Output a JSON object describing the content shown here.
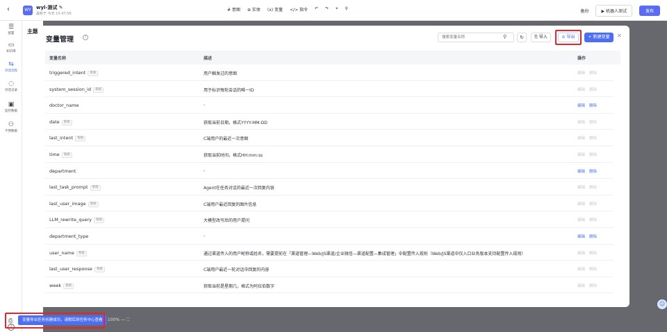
{
  "app": {
    "project_avatar": "WY",
    "project_name": "wyl-测试 ✎",
    "saved_text": "最新于 今天 15:47:56",
    "top_menu": [
      "# 意图",
      "⊕ 实体",
      "(x) 变量",
      "</> 指令",
      "↶",
      "↷",
      "⌖",
      "⚲"
    ],
    "backup_label": "备份",
    "test_label": "▶ 机器人测试",
    "publish_label": "发布",
    "left_nav": [
      {
        "label": "配置",
        "icon": "sliders-icon"
      },
      {
        "label": "知识库",
        "icon": "book-icon"
      },
      {
        "label": "对话流程",
        "icon": "flow-icon",
        "active": true
      },
      {
        "label": "对话记录",
        "icon": "chat-icon"
      },
      {
        "label": "监控数据",
        "icon": "monitor-icon"
      },
      {
        "label": "干预数据",
        "icon": "people-icon"
      }
    ],
    "subpanel_title": "主题",
    "zoom_text": "+  100%  —  ⛶",
    "toast": "变量导出任务创建成功，请稍后到任务中心查看"
  },
  "modal": {
    "title": "变量管理",
    "search_placeholder": "搜索变量名称",
    "import_label": "⎘ 导入",
    "export_label": "⊘ 导出",
    "new_label": "+ 新建变量",
    "close": "✕",
    "columns": {
      "name": "变量名称",
      "desc": "描述",
      "ops": "操作"
    },
    "edit_label": "编辑",
    "delete_label": "删除",
    "system_tag": "系统",
    "rows": [
      {
        "name": "triggered_intent",
        "system": true,
        "desc": "用户触发过的意图"
      },
      {
        "name": "system_session_id",
        "system": true,
        "desc": "用于标识每轮会话的唯一ID"
      },
      {
        "name": "doctor_name",
        "system": false,
        "desc": "-"
      },
      {
        "name": "date",
        "system": true,
        "desc": "获取当前日期，格式YYYY-MM-DD"
      },
      {
        "name": "last_intent",
        "system": true,
        "desc": "C端用户的最近一次意图"
      },
      {
        "name": "time",
        "system": true,
        "desc": "获取当前时间，格式HH:mm:ss"
      },
      {
        "name": "department",
        "system": false,
        "desc": "-"
      },
      {
        "name": "last_task_prompt",
        "system": true,
        "desc": "Agent在任务对话的最近一次回复内容"
      },
      {
        "name": "last_user_image",
        "system": true,
        "desc": "C端用户最近回复的图片信息"
      },
      {
        "name": "LLM_rewrite_query",
        "system": true,
        "desc": "大模型改写后的用户提问"
      },
      {
        "name": "department_type",
        "system": false,
        "desc": "-"
      },
      {
        "name": "user_name",
        "system": true,
        "desc": "通过渠道传入的用户昵称或姓名，需要提前在「渠道管理—Web/JS渠道/企业微信—渠道配置—集成管理」中配置传入规则（Web/JS渠道中仅入口业务版本支持配置传入规则）"
      },
      {
        "name": "last_user_response",
        "system": true,
        "desc": "C端用户最近一轮对话中回复的内容"
      },
      {
        "name": "week",
        "system": true,
        "desc": "获取当前是星期几，格式为阿拉伯数字"
      }
    ]
  }
}
